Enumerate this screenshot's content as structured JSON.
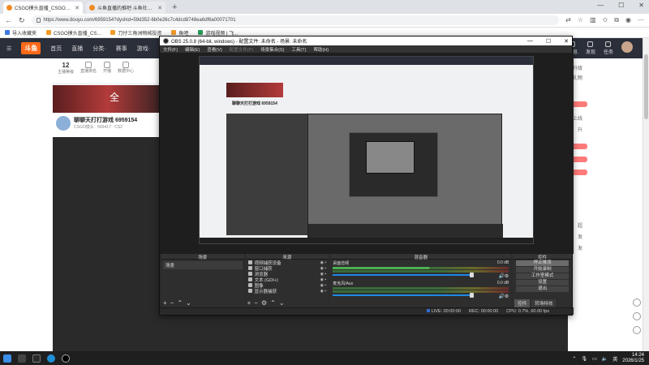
{
  "browser": {
    "tabs": [
      {
        "title": "CSGO摸头直播_CSGO摸头直播",
        "active": true
      },
      {
        "title": "斗鱼直播的推吧 斗鱼社区 直播间",
        "active": false
      }
    ],
    "new_tab": "+",
    "window_controls": [
      "—",
      "☐",
      "✕"
    ],
    "url": "https://www.douyu.com/6959154?dyshid=59d352-6b0e26c7c4dcd8748ea6df6a00071701",
    "bookmarks": [
      "导入收藏夹",
      "CSGO摸头直播_CS...",
      "刀仔三角洲物械投资",
      "鱼吧",
      "游戏视频 | 飞..."
    ]
  },
  "site": {
    "logo": "斗鱼",
    "nav": [
      "首页",
      "直播",
      "分类·",
      "赛事",
      "游戏·"
    ],
    "right_items": [
      "消息",
      "发现",
      "任务"
    ],
    "stats": [
      {
        "value": "12",
        "label": "主播等级"
      },
      {
        "value": "",
        "label": "直播排名"
      },
      {
        "value": "",
        "label": "开播"
      },
      {
        "value": "",
        "label": "数据中心"
      }
    ],
    "banner_text": "全",
    "streamer_name": "聊聊天打打游戏 6959154",
    "streamer_meta": "CSGO摸头  · 565417  · CS2",
    "right_texts": [
      "升级",
      "礼物",
      "上线",
      "升",
      "超",
      "发",
      "发"
    ]
  },
  "obs": {
    "title": "OBS 25.0.8 (64-bit, windows) - 配置文件: 未命名 - 场景: 未命名",
    "menu": [
      "文件(F)",
      "编辑(E)",
      "查看(V)",
      "配置文件(P)",
      "场景集合(S)",
      "工具(T)",
      "帮助(H)"
    ],
    "docks": {
      "scenes": {
        "header": "场景",
        "items": [
          "场景"
        ]
      },
      "sources": {
        "header": "来源",
        "items": [
          "视频捕获设备",
          "窗口捕获",
          "浏览器",
          "文本 (GDI+)",
          "图像",
          "显示器捕获"
        ]
      },
      "mixer": {
        "header": "混音器",
        "channels": [
          {
            "name": "桌面音频",
            "db": "0.0 dB"
          },
          {
            "name": "麦克风/Aux",
            "db": "0.0 dB"
          }
        ]
      },
      "controls": {
        "header": "控件",
        "buttons": [
          "停止推流",
          "开始录制",
          "工作室模式",
          "设置",
          "退出"
        ],
        "tabs": [
          "控件",
          "转场特效"
        ]
      }
    },
    "status": {
      "dropped": "LIVE: 00:00:00",
      "rec": "REC: 00:00:00",
      "cpu": "CPU: 0.7%, 60.00 fps"
    }
  },
  "taskbar": {
    "time": "14:24",
    "date": "2026/1/25",
    "lang": "英"
  }
}
